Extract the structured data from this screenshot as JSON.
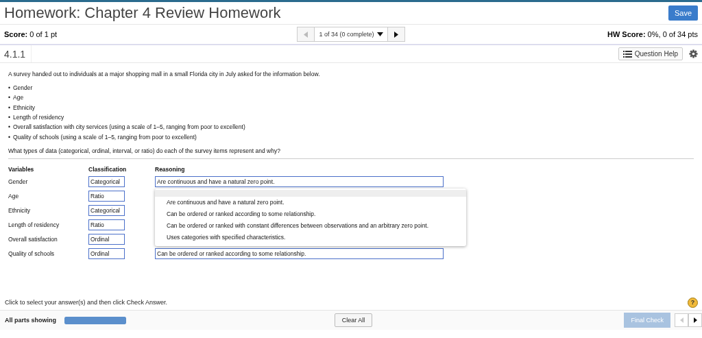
{
  "header": {
    "title": "Homework: Chapter 4 Review Homework",
    "save": "Save",
    "score_label": "Score:",
    "score": "0 of 1 pt",
    "nav_status": "1 of 34 (0 complete)",
    "hw_score_label": "HW Score:",
    "hw_score": "0%, 0 of 34 pts",
    "question_number": "4.1.1",
    "help": "Question Help"
  },
  "question": {
    "intro": "A survey handed out to individuals at a major shopping mall in a small Florida city in July asked for the information below.",
    "bullet": "•",
    "items": [
      "Gender",
      "Age",
      "Ethnicity",
      "Length of residency",
      "Overall satisfaction with city services (using a scale of 1–5, ranging from poor to excellent)",
      "Quality of schools (using a scale of 1–5, ranging from poor to excellent)"
    ],
    "prompt": "What types of data (categorical, ordinal, interval, or ratio) do each of the survey items represent and why?",
    "columns": [
      "Variables",
      "Classification",
      "Reasoning"
    ],
    "rows": [
      {
        "variable": "Gender",
        "classification": "Categorical",
        "reasoning": "Are continuous and have a natural zero point."
      },
      {
        "variable": "Age",
        "classification": "Ratio"
      },
      {
        "variable": "Ethnicity",
        "classification": "Categorical"
      },
      {
        "variable": "Length of residency",
        "classification": "Ratio"
      },
      {
        "variable": "Overall satisfaction",
        "classification": "Ordinal"
      },
      {
        "variable": "Quality of schools",
        "classification": "Ordinal",
        "reasoning": "Can be ordered or ranked according to some relationship."
      }
    ],
    "dropdown": {
      "expanded": true,
      "options": [
        {
          "selected": true
        },
        {
          "label": "Are continuous and have a natural zero point.",
          "selected": false
        },
        {
          "label": "Can be ordered or ranked according to some relationship.",
          "selected": false
        },
        {
          "label": "Can be ordered or ranked with constant differences between observations and an arbitrary zero point.",
          "selected": false
        },
        {
          "label": "Uses categories with specified characteristics.",
          "selected": false
        }
      ]
    }
  },
  "footer": {
    "instruction": "Click to select your answer(s) and then click Check Answer.",
    "help_icon": "?",
    "parts": "All parts showing",
    "progress": {
      "level": 1
    },
    "clear": "Clear All",
    "final": "Final Check"
  }
}
